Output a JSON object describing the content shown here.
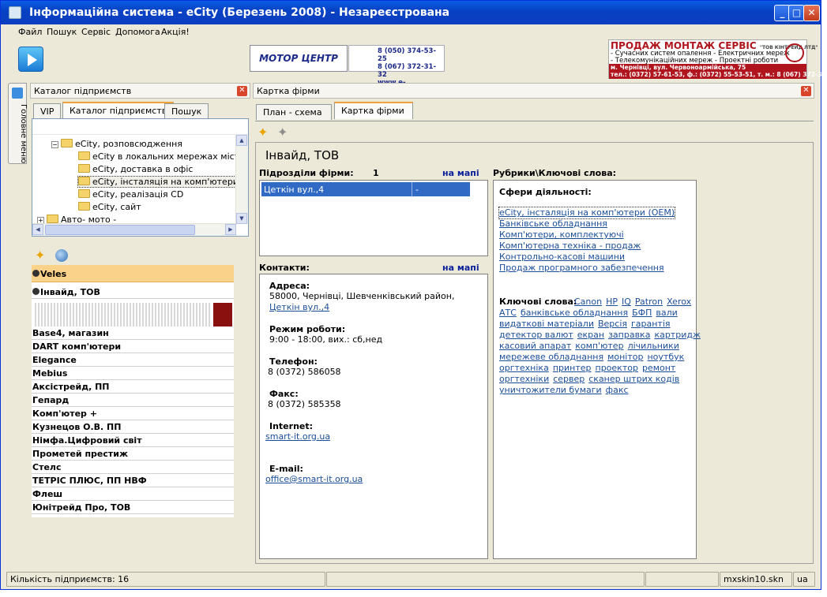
{
  "window": {
    "title": "Інформаційна система - eCity (Березень 2008) - Незареєстрована"
  },
  "menu": [
    "Файл",
    "Пошук",
    "Сервіс",
    "Допомога",
    "Акція!"
  ],
  "ads": {
    "motor": "МОТОР ЦЕНТР",
    "phone1": "8 (050) 374-53-25",
    "phone2": "8 (067) 372-31-32",
    "site": "www.e-city.com.ua",
    "right_title": "ПРОДАЖ МОНТАЖ СЕРВІС",
    "right_company": "\"ТОВ КІНТРЕЙД ЛТД\"",
    "right_l1": "- Сучасних систем опалення - Електричних мереж",
    "right_l2": "- Телекомунікаційних мереж - Проектні роботи",
    "right_addr": "м. Чернівці, вул. Червоноармійська, 75",
    "right_tel": "тел.: (0372) 57-61-53, ф.: (0372) 55-53-51, т. м.: 8 (067) 372-31-32"
  },
  "sidebar_vertical_tab": "Головне меню",
  "catalog": {
    "title": "Каталог підприємств",
    "tabs": [
      "VIP",
      "Каталог підприємств",
      "Пошук"
    ],
    "tree": [
      {
        "label": "eCity, розповсюдження",
        "level": 1,
        "expanded": true
      },
      {
        "label": "eCity в локальних мережах міста",
        "level": 2
      },
      {
        "label": "eCity, доставка в офіс",
        "level": 2
      },
      {
        "label": "eCity, інсталяція на комп'ютери (OEM)",
        "level": 2,
        "selected": true
      },
      {
        "label": "eCity, реалізація CD",
        "level": 2
      },
      {
        "label": "eCity, сайт",
        "level": 2
      },
      {
        "label": "Авто- мото -",
        "level": 0,
        "expanded": false
      }
    ],
    "firms": [
      "Veles",
      "Інвайд, ТОВ",
      "Base4, магазин",
      "DART комп'ютери",
      "Elegance",
      "Mebius",
      "Аксістрейд, ПП",
      "Гепард",
      "Комп'ютер +",
      "Кузнецов О.В. ПП",
      "Німфа.Цифровий світ",
      "Прометей престиж",
      "Стелс",
      "ТЕТРІС ПЛЮС, ПП НВФ",
      "Флеш",
      "Юнітрейд Про, ТОВ"
    ]
  },
  "card": {
    "panel_title": "Картка фірми",
    "tabs": [
      "План - схема",
      "Картка фірми"
    ],
    "firm_name": "Інвайд, ТОВ",
    "subdivisions": {
      "label": "Підрозділи фірми:",
      "count": "1",
      "map_link": "на мапі",
      "rows": [
        {
          "address": "Цеткін вул.,4",
          "extra": "-"
        }
      ]
    },
    "contacts": {
      "label": "Контакти:",
      "map_link": "на мапі",
      "address_label": "Адреса:",
      "address_line": "58000, Чернівці,  Шевченківський район,",
      "address_link": "Цеткін вул.,4",
      "hours_label": "Режим роботи:",
      "hours": "9:00 - 18:00, вих.: сб,нед",
      "phone_label": "Телефон:",
      "phone": "8 (0372) 586058",
      "fax_label": "Факс:",
      "fax": "8 (0372) 585358",
      "internet_label": "Internet:",
      "internet": "smart-it.org.ua",
      "email_label": "E-mail:",
      "email": "office@smart-it.org.ua"
    },
    "rubrics": {
      "label": "Рубрики\\Ключові слова:",
      "spheres_label": "Сфери діяльності:",
      "spheres": [
        "eCity, інсталяція на комп'ютери (OEM)",
        "Банківське обладнання",
        "Комп'ютери, комплектуючі",
        "Комп'ютерна техніка - продаж",
        "Контрольно-касові машини",
        "Продаж програмного забезпечення"
      ],
      "keywords_label": "Ключові слова:",
      "keyword_lines": [
        [
          "Canon",
          "HP",
          "IQ",
          "Patron",
          "Xerox"
        ],
        [
          "АТС",
          "банківське обладнання",
          "БФП",
          "вали"
        ],
        [
          "видаткові матеріали",
          "Версія",
          "гарантія"
        ],
        [
          "детектор валют",
          "екран",
          "заправка",
          "картридж"
        ],
        [
          "касовий апарат",
          "комп'ютер",
          "лічильники"
        ],
        [
          "мережеве обладнання",
          "монітор",
          "ноутбук"
        ],
        [
          "оргтехніка",
          "принтер",
          "проектор",
          "ремонт"
        ],
        [
          "оргтехніки",
          "сервер",
          "сканер штрих кодів"
        ],
        [
          "уничтожители бумаги",
          "факс"
        ]
      ]
    }
  },
  "status": {
    "count": "Кількість підприємств: 16",
    "skin": "mxskin10.skn",
    "lang": "ua"
  },
  "colors": {
    "title_blue": "#0842c4",
    "accent_orange": "#fbd28a",
    "link": "#1b4e9a",
    "select_blue": "#316ac5"
  }
}
